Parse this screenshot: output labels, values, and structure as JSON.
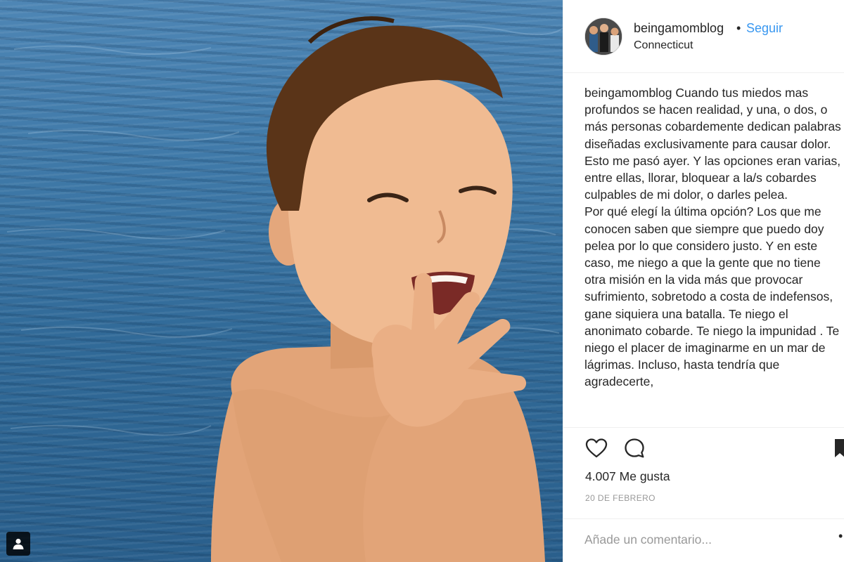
{
  "header": {
    "username": "beingamomblog",
    "separator": "•",
    "follow_label": "Seguir",
    "location": "Connecticut"
  },
  "caption": {
    "username": "beingamomblog",
    "text": " Cuando tus miedos mas profundos se hacen realidad, y una, o dos, o más personas cobardemente dedican palabras diseñadas exclusivamente para causar dolor.\nEsto me pasó ayer. Y las opciones eran varias, entre ellas, llorar, bloquear a la/s cobardes culpables de mi dolor, o darles pelea.\nPor qué elegí la última opción? Los que me conocen saben que siempre que puedo doy pelea por lo que considero justo. Y en este caso, me niego a que la gente que no tiene otra misión en la vida más que provocar sufrimiento, sobretodo a costa de indefensos, gane siquiera una batalla. Te niego el anonimato cobarde. Te niego la impunidad . Te niego el placer de imaginarme en un mar de lágrimas. Incluso, hasta tendría que agradecerte,"
  },
  "icons": {
    "like": "heart-icon",
    "comment": "comment-bubble-icon",
    "save": "bookmark-icon",
    "user_tag": "user-tag-icon",
    "more": "more-options-icon"
  },
  "stats": {
    "likes": "4.007 Me gusta",
    "date": "20 DE FEBRERO"
  },
  "comment": {
    "placeholder": "Añade un comentario...",
    "more_symbol": "•"
  },
  "colors": {
    "link_blue": "#3897f0",
    "text": "#262626",
    "muted": "#999999",
    "divider": "#efefef",
    "water": "#3f79a8"
  }
}
